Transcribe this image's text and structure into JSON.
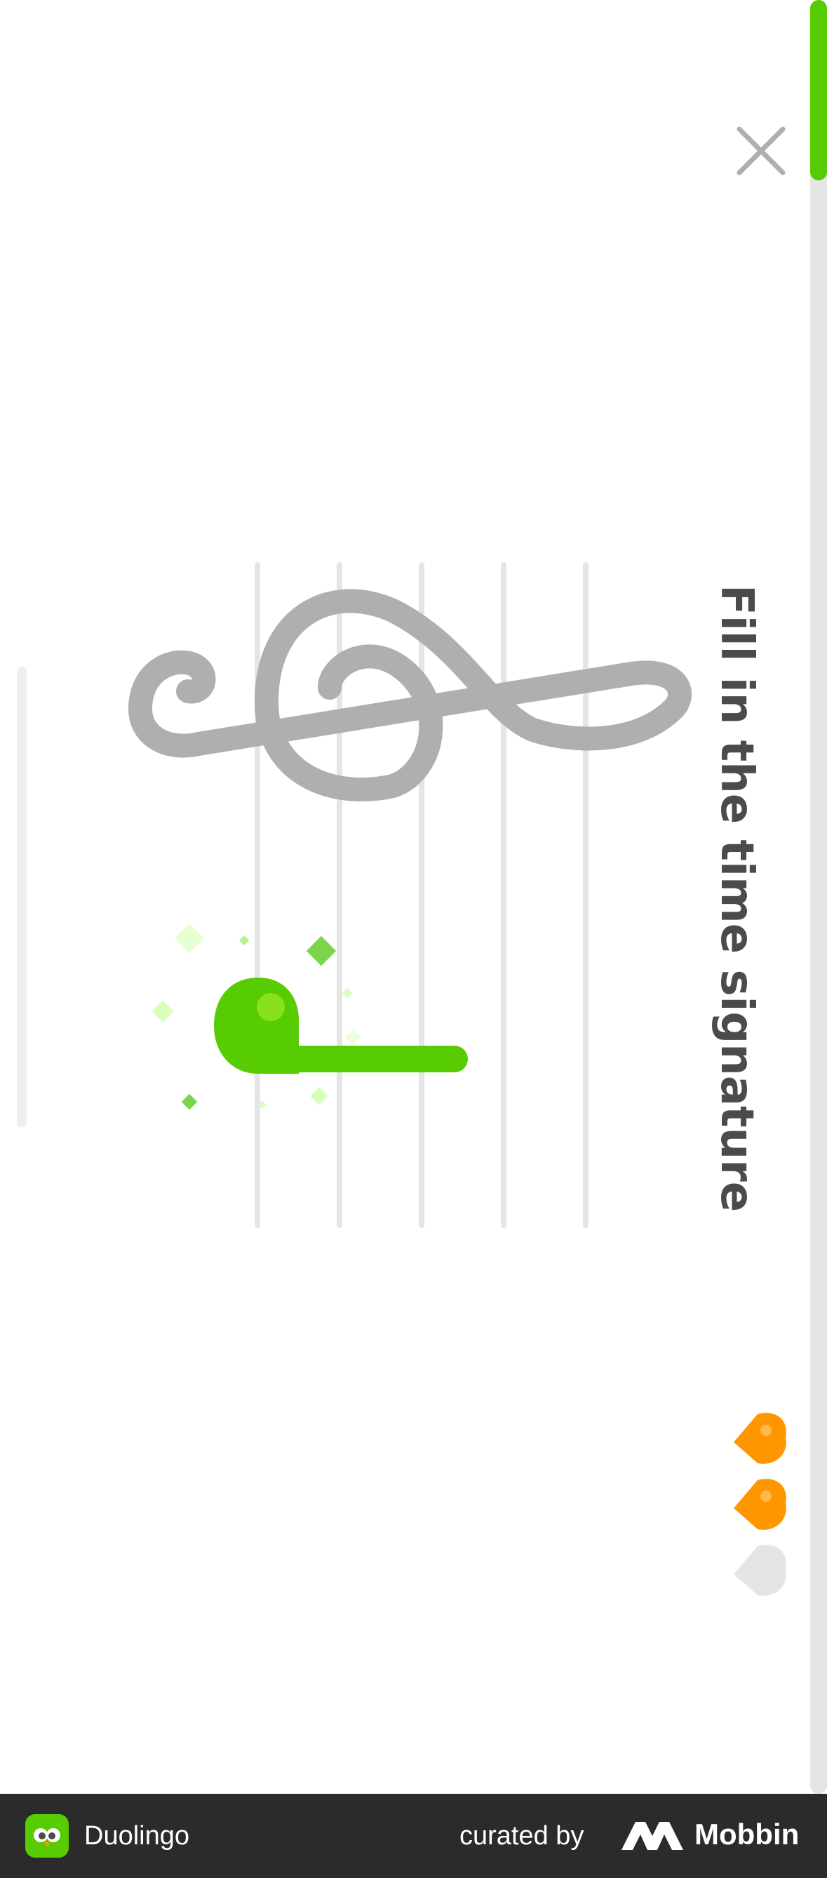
{
  "header": {
    "close_icon": "close-icon",
    "progress": 0.03,
    "hearts_total": 3,
    "hearts_remaining": 2
  },
  "lesson": {
    "prompt": "Fill in the time signature"
  },
  "footer": {
    "app_name": "Duolingo",
    "curated_by": "curated by",
    "brand": "Mobbin"
  },
  "colors": {
    "accent_green": "#58cc02",
    "heart_orange": "#ff9600",
    "staff_gray": "#afafaf",
    "track_gray": "#e5e5e5"
  }
}
